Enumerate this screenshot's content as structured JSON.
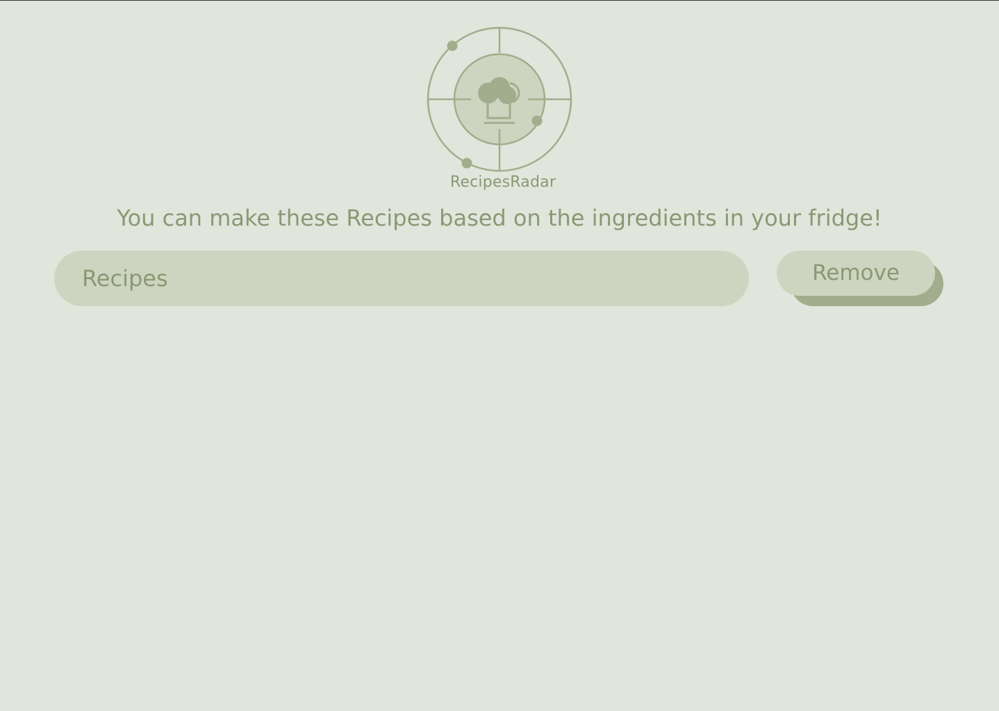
{
  "brand": {
    "name": "RecipesRadar",
    "logo_icon": "chef-hat-radar-icon"
  },
  "headline": "You can make these Recipes based on the ingredients in your fridge!",
  "recipes_field": {
    "label": "Recipes"
  },
  "actions": {
    "remove_label": "Remove"
  },
  "colors": {
    "background": "#e0e6dc",
    "panel": "#cdd5c0",
    "accent": "#a1ad8c",
    "text": "#8a9873"
  }
}
